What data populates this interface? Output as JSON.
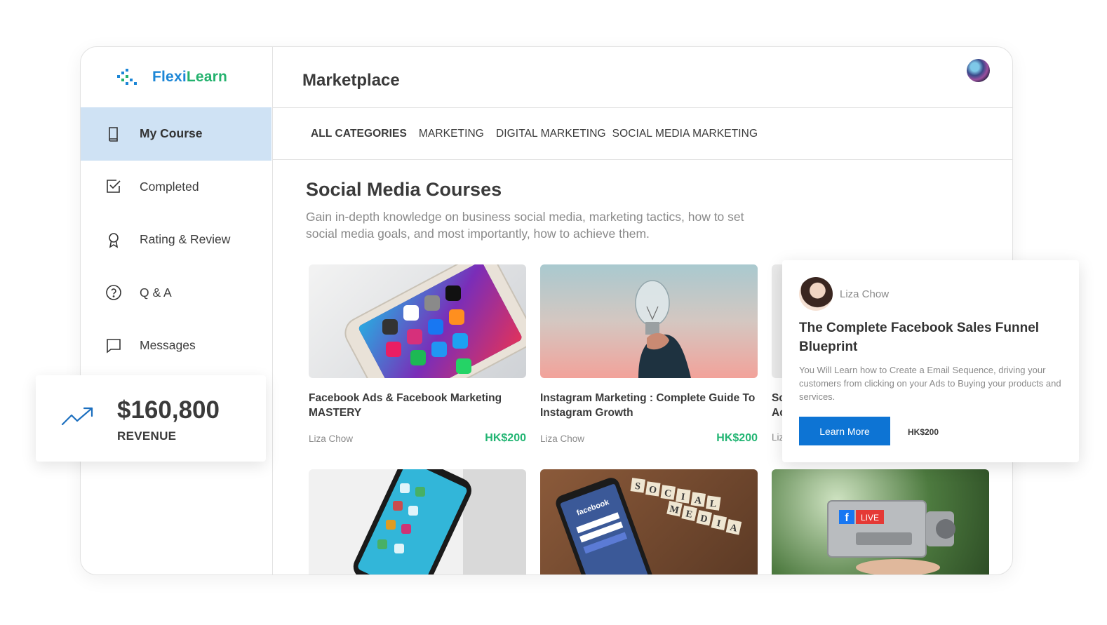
{
  "brand": {
    "name_part1": "Flexi",
    "name_part2": "Learn"
  },
  "sidebar": {
    "items": [
      {
        "label": "My Course",
        "icon": "book-icon",
        "active": true
      },
      {
        "label": "Completed",
        "icon": "checkbox-icon"
      },
      {
        "label": "Rating & Review",
        "icon": "award-icon"
      },
      {
        "label": "Q & A",
        "icon": "help-circle-icon"
      },
      {
        "label": "Messages",
        "icon": "message-icon"
      }
    ]
  },
  "header": {
    "title": "Marketplace",
    "avatar": "user-avatar"
  },
  "tabs": [
    "ALL CATEGORIES",
    "MARKETING",
    "DIGITAL MARKETING",
    "SOCIAL MEDIA MARKETING"
  ],
  "section": {
    "title": "Social Media Courses",
    "description": "Gain in-depth knowledge on business social media, marketing tactics, how to set social media goals, and most importantly, how to achieve them."
  },
  "courses": [
    {
      "title": "Facebook Ads & Facebook Marketing MASTERY",
      "author": "Liza Chow",
      "price": "HK$200"
    },
    {
      "title": "Instagram Marketing : Complete Guide To Instagram Growth",
      "author": "Liza Chow",
      "price": "HK$200"
    },
    {
      "title": "Sc\nAc",
      "author": "Liz"
    }
  ],
  "second_row_images": {
    "card4": {
      "description": "smartphone-on-laptop"
    },
    "card5": {
      "tiles_row1": [
        "S",
        "O",
        "C",
        "I",
        "A",
        "L"
      ],
      "tiles_row2": [
        "M",
        "E",
        "D",
        "I",
        "A"
      ],
      "phone_text": "facebook"
    },
    "card6": {
      "live_badge": "LIVE"
    }
  },
  "revenue": {
    "value": "$160,800",
    "label": "REVENUE"
  },
  "popup": {
    "author": "Liza Chow",
    "title": "The Complete Facebook Sales Funnel Blueprint",
    "description": "You Will Learn how to Create a Email Sequence, driving your customers from clicking on your Ads to Buying your products and services.",
    "button": "Learn More",
    "price": "HK$200"
  },
  "colors": {
    "accent": "#0d74d4",
    "price": "#22b573",
    "active_nav": "#cfe2f4",
    "brand_blue": "#1c86d6",
    "brand_green": "#24b26e"
  }
}
